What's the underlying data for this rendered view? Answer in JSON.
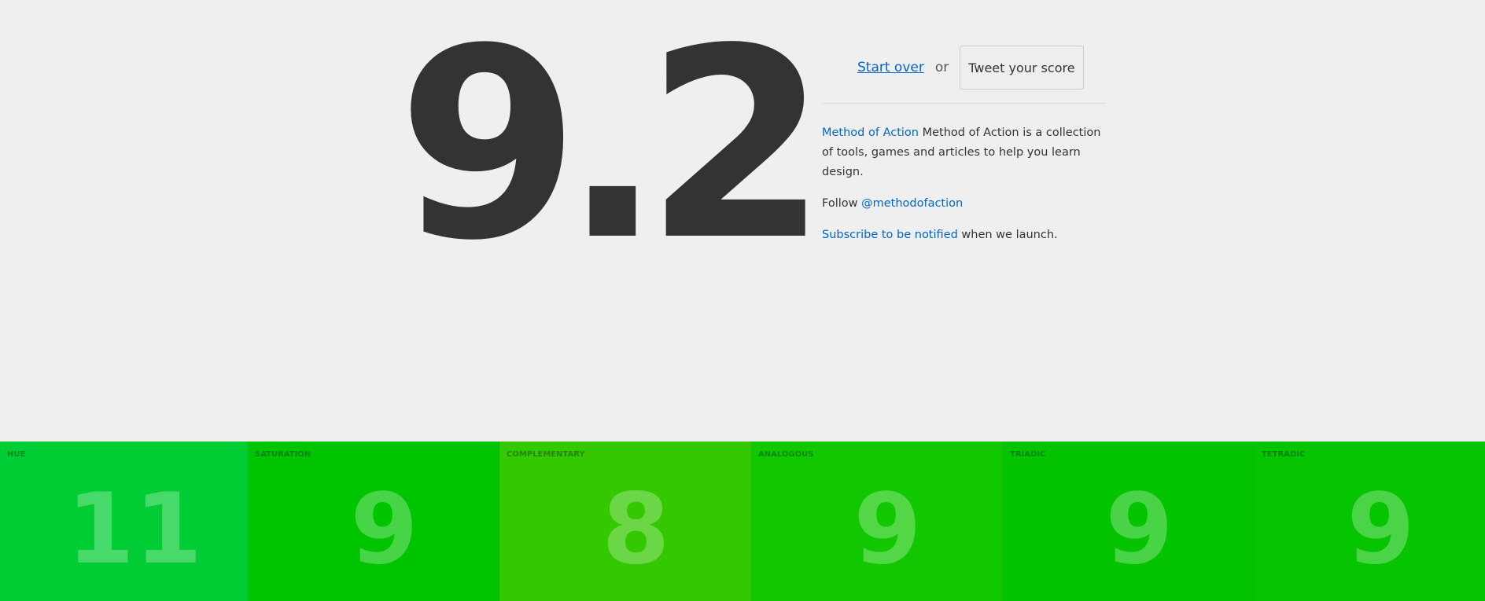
{
  "score": "9.2",
  "actions": {
    "start_over": "Start over",
    "or": "or",
    "tweet": "Tweet your score"
  },
  "about": {
    "brand_link": "Method of Action",
    "description": " Method of Action is a collection of tools, games and articles to help you learn design.",
    "follow_prefix": "Follow ",
    "follow_handle": "@methodofaction",
    "subscribe_link": "Subscribe to be notified",
    "subscribe_suffix": " when we launch."
  },
  "colors": {
    "link": "#0066cc",
    "score_text": "#333333",
    "background": "#efefef"
  },
  "tiles": [
    {
      "label": "HUE",
      "value": "11",
      "color": "#00cc33"
    },
    {
      "label": "SATURATION",
      "value": "9",
      "color": "#00c400"
    },
    {
      "label": "COMPLEMENTARY",
      "value": "8",
      "color": "#33c800"
    },
    {
      "label": "ANALOGOUS",
      "value": "9",
      "color": "#11c800"
    },
    {
      "label": "TRIADIC",
      "value": "9",
      "color": "#04c400"
    },
    {
      "label": "TETRADIC",
      "value": "9",
      "color": "#06c400"
    }
  ]
}
